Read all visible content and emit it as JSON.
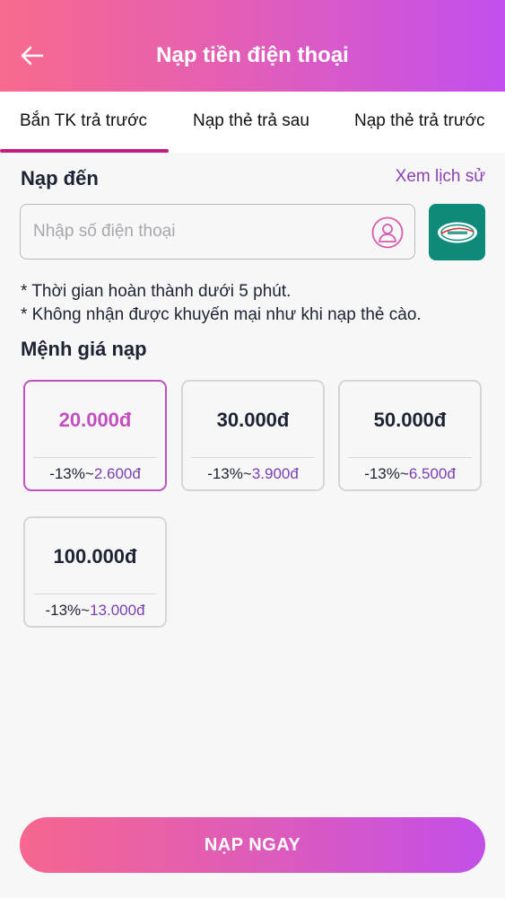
{
  "header": {
    "title": "Nạp tiền điện thoại"
  },
  "tabs": [
    {
      "label": "Bắn TK trả trước",
      "active": true
    },
    {
      "label": "Nạp thẻ trả sau",
      "active": false
    },
    {
      "label": "Nạp thẻ trả trước",
      "active": false
    }
  ],
  "recipient": {
    "title": "Nạp đến",
    "history_link": "Xem lịch sử",
    "phone_placeholder": "Nhập số điện thoại",
    "phone_value": "",
    "carrier_icon": "viettel-logo-icon",
    "carrier_color": "#0e8a7b"
  },
  "notes": [
    "* Thời gian hoàn thành dưới 5 phút.",
    "* Không nhận được khuyến mại như khi nạp thẻ cào."
  ],
  "denominations": {
    "title": "Mệnh giá nạp",
    "options": [
      {
        "amount": "20.000đ",
        "discount": "-13%~",
        "discount_value": "2.600đ",
        "selected": true
      },
      {
        "amount": "30.000đ",
        "discount": "-13%~",
        "discount_value": "3.900đ",
        "selected": false
      },
      {
        "amount": "50.000đ",
        "discount": "-13%~",
        "discount_value": "6.500đ",
        "selected": false
      },
      {
        "amount": "100.000đ",
        "discount": "-13%~",
        "discount_value": "13.000đ",
        "selected": false
      }
    ]
  },
  "submit": {
    "label": "NẠP NGAY"
  },
  "colors": {
    "accent": "#c24fbf",
    "brand_gradient_start": "#f86a8d",
    "brand_gradient_end": "#c24fee"
  }
}
